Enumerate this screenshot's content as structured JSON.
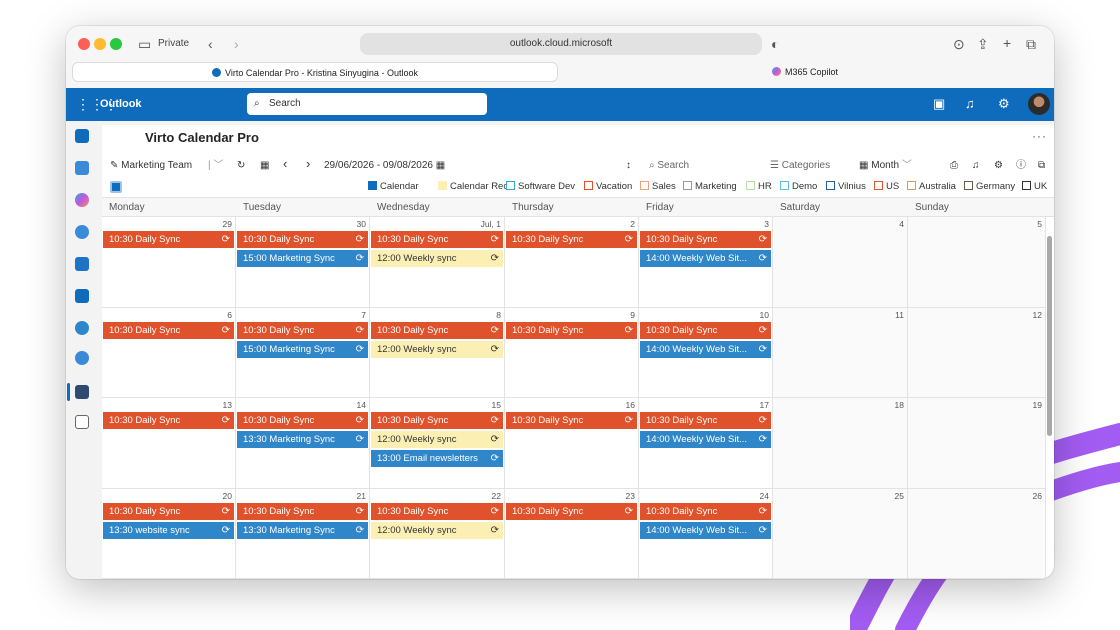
{
  "browser": {
    "private_label": "Private",
    "url": "outlook.cloud.microsoft",
    "tabs": [
      {
        "label": "Virto Calendar Pro - Kristina Sinyugina - Outlook"
      },
      {
        "label": "M365 Copilot"
      }
    ]
  },
  "outlook": {
    "app_name": "Outlook",
    "search_placeholder": "Search",
    "brand_color": "#0f6cbd"
  },
  "calendar": {
    "title": "Virto Calendar Pro",
    "toolbar": {
      "team": "Marketing Team",
      "date_range": "29/06/2026 - 09/08/2026",
      "search_placeholder": "Search",
      "categories_label": "Categories",
      "view_label": "Month"
    },
    "legend": [
      {
        "label": "Calendar",
        "color": "#0f6cbd",
        "filled": true
      },
      {
        "label": "Calendar Recu",
        "color": "#fcefb4",
        "filled": true
      },
      {
        "label": "Software Dev",
        "color": "#2fa8d5",
        "filled": false
      },
      {
        "label": "Vacation",
        "color": "#e0522b",
        "filled": false
      },
      {
        "label": "Sales",
        "color": "#f2a07a",
        "filled": false
      },
      {
        "label": "Marketing",
        "color": "#9a9a9a",
        "filled": false
      },
      {
        "label": "HR",
        "color": "#b9dfa8",
        "filled": false
      },
      {
        "label": "Demo",
        "color": "#5bc0de",
        "filled": false
      },
      {
        "label": "Vilnius",
        "color": "#1f5fa8",
        "filled": false
      },
      {
        "label": "US",
        "color": "#e0522b",
        "filled": false
      },
      {
        "label": "Australia",
        "color": "#f0905a",
        "filled": false
      },
      {
        "label": "Germany",
        "color": "#6b5a4a",
        "filled": false
      },
      {
        "label": "UK",
        "color": "#333333",
        "filled": false
      }
    ],
    "days": [
      "Monday",
      "Tuesday",
      "Wednesday",
      "Thursday",
      "Friday",
      "Saturday",
      "Sunday"
    ],
    "weeks": [
      {
        "dates": [
          "29",
          "30",
          "Jul, 1",
          "2",
          "3",
          "4",
          "5"
        ],
        "events": [
          [
            {
              "text": "10:30 Daily Sync",
              "style": "red"
            }
          ],
          [
            {
              "text": "10:30 Daily Sync",
              "style": "red"
            },
            {
              "text": "15:00 Marketing Sync",
              "style": "blue"
            }
          ],
          [
            {
              "text": "10:30 Daily Sync",
              "style": "red"
            },
            {
              "text": "12:00 Weekly sync",
              "style": "yellow"
            }
          ],
          [
            {
              "text": "10:30 Daily Sync",
              "style": "red"
            }
          ],
          [
            {
              "text": "10:30 Daily Sync",
              "style": "red"
            },
            {
              "text": "14:00 Weekly Web Sit...",
              "style": "blue"
            }
          ],
          [],
          []
        ]
      },
      {
        "dates": [
          "6",
          "7",
          "8",
          "9",
          "10",
          "11",
          "12"
        ],
        "events": [
          [
            {
              "text": "10:30 Daily Sync",
              "style": "red"
            }
          ],
          [
            {
              "text": "10:30 Daily Sync",
              "style": "red"
            },
            {
              "text": "15:00 Marketing Sync",
              "style": "blue"
            }
          ],
          [
            {
              "text": "10:30 Daily Sync",
              "style": "red"
            },
            {
              "text": "12:00 Weekly sync",
              "style": "yellow"
            }
          ],
          [
            {
              "text": "10:30 Daily Sync",
              "style": "red"
            }
          ],
          [
            {
              "text": "10:30 Daily Sync",
              "style": "red"
            },
            {
              "text": "14:00 Weekly Web Sit...",
              "style": "blue"
            }
          ],
          [],
          []
        ]
      },
      {
        "dates": [
          "13",
          "14",
          "15",
          "16",
          "17",
          "18",
          "19"
        ],
        "events": [
          [
            {
              "text": "10:30 Daily Sync",
              "style": "red"
            }
          ],
          [
            {
              "text": "10:30 Daily Sync",
              "style": "red"
            },
            {
              "text": "13:30 Marketing Sync",
              "style": "blue"
            }
          ],
          [
            {
              "text": "10:30 Daily Sync",
              "style": "red"
            },
            {
              "text": "12:00 Weekly sync",
              "style": "yellow"
            },
            {
              "text": "13:00 Email newsletters",
              "style": "blue"
            }
          ],
          [
            {
              "text": "10:30 Daily Sync",
              "style": "red"
            }
          ],
          [
            {
              "text": "10:30 Daily Sync",
              "style": "red"
            },
            {
              "text": "14:00 Weekly Web Sit...",
              "style": "blue"
            }
          ],
          [],
          []
        ]
      },
      {
        "dates": [
          "20",
          "21",
          "22",
          "23",
          "24",
          "25",
          "26"
        ],
        "events": [
          [
            {
              "text": "10:30 Daily Sync",
              "style": "red"
            },
            {
              "text": "13:30 website sync",
              "style": "blue"
            }
          ],
          [
            {
              "text": "10:30 Daily Sync",
              "style": "red"
            },
            {
              "text": "13:30 Marketing Sync",
              "style": "blue"
            }
          ],
          [
            {
              "text": "10:30 Daily Sync",
              "style": "red"
            },
            {
              "text": "12:00 Weekly sync",
              "style": "yellow"
            }
          ],
          [
            {
              "text": "10:30 Daily Sync",
              "style": "red"
            }
          ],
          [
            {
              "text": "10:30 Daily Sync",
              "style": "red"
            },
            {
              "text": "14:00 Weekly Web Sit...",
              "style": "blue"
            }
          ],
          [],
          []
        ]
      }
    ]
  }
}
